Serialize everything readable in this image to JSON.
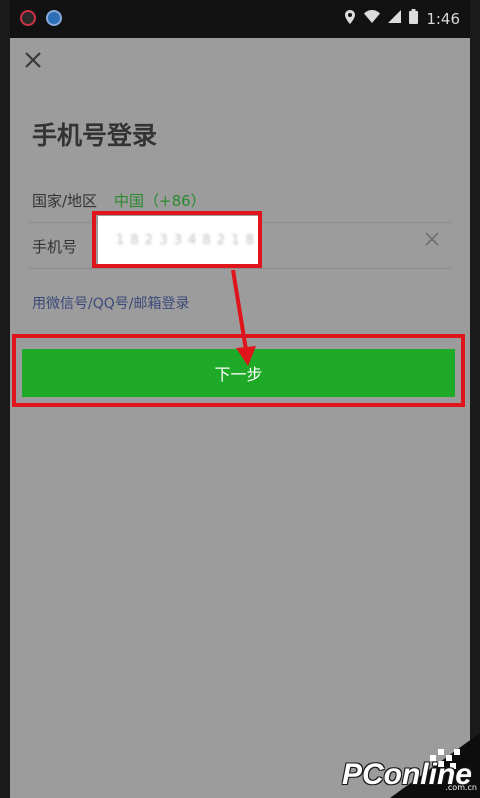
{
  "status_bar": {
    "time": "1:46"
  },
  "header": {
    "title": "手机号登录"
  },
  "form": {
    "country_label": "国家/地区",
    "country_value": "中国（+86）",
    "phone_label": "手机号",
    "phone_value": "1 8 2 3 3 4 8 2 1 8"
  },
  "alt_login": "用微信号/QQ号/邮箱登录",
  "next_button": "下一步",
  "watermark": {
    "brand": "PConline",
    "suffix": ".com.cn"
  },
  "colors": {
    "accent_green": "#1eaa28",
    "highlight_red": "#e0151b"
  },
  "icons": [
    "close-icon",
    "location-icon",
    "wifi-icon",
    "signal-icon",
    "battery-icon",
    "clear-icon",
    "arrow-icon"
  ]
}
